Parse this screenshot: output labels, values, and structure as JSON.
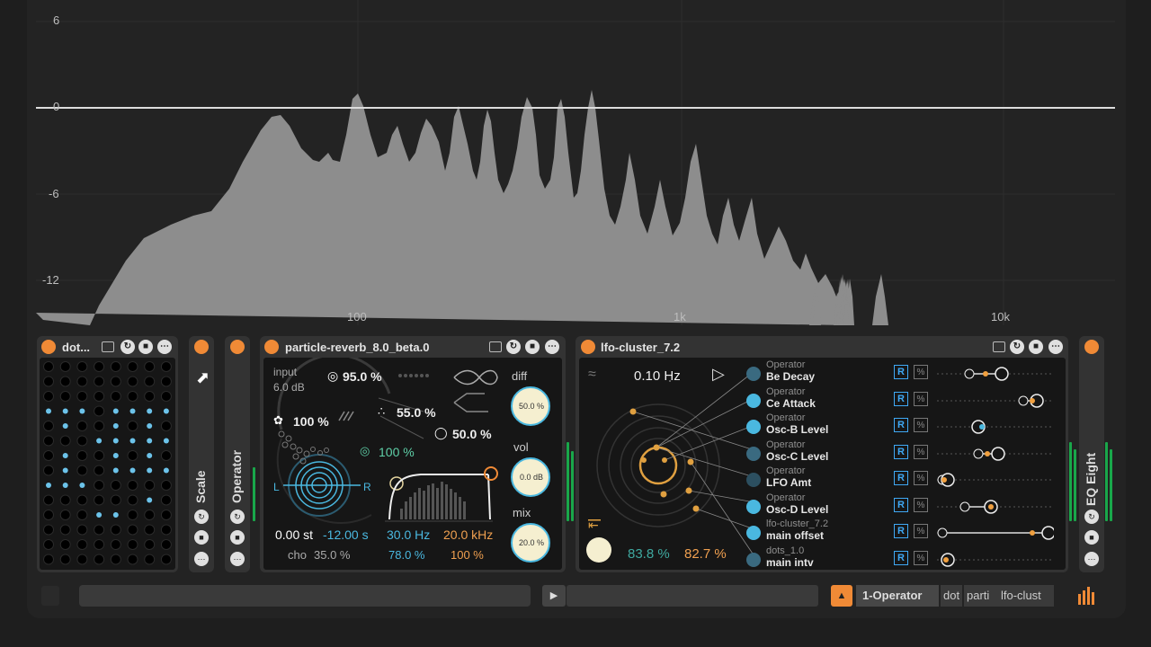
{
  "analyzer": {
    "db_labels": [
      "6",
      "0",
      "-6",
      "-12"
    ],
    "freq_labels": [
      "100",
      "1k",
      "10k"
    ]
  },
  "devices": {
    "dots": {
      "title": "dot..."
    },
    "scale": {
      "title": "Scale"
    },
    "operator": {
      "title": "Operator"
    },
    "reverb": {
      "title": "particle-reverb_8.0_beta.0",
      "input_label": "input",
      "input_value": "6.0 dB",
      "p1": "95.0 %",
      "p2": "100 %",
      "p3": "55.0 %",
      "p4": "50.0 %",
      "p5": "100 %",
      "L": "L",
      "R": "R",
      "pitch": "0.00 st",
      "time": "-12.00 s",
      "freq_low": "30.0 Hz",
      "freq_high": "20.0 kHz",
      "cho_label": "cho",
      "cho_value": "35.0 %",
      "v2": "78.0 %",
      "v3": "100 %",
      "diff_label": "diff",
      "diff_value": "50.0 %",
      "vol_label": "vol",
      "vol_value": "0.0 dB",
      "mix_label": "mix",
      "mix_value": "20.0 %"
    },
    "lfo": {
      "title": "lfo-cluster_7.2",
      "rate": "0.10 Hz",
      "pct1": "83.8 %",
      "pct2": "82.7 %",
      "targets": [
        {
          "device": "Operator",
          "param": "Be Decay",
          "color": "#3a6a80"
        },
        {
          "device": "Operator",
          "param": "Ce Attack",
          "color": "#4ab8e0"
        },
        {
          "device": "Operator",
          "param": "Osc-B Level",
          "color": "#4ab8e0"
        },
        {
          "device": "Operator",
          "param": "Osc-C Level",
          "color": "#3a6a80"
        },
        {
          "device": "Operator",
          "param": "LFO Amt",
          "color": "#2c4f60"
        },
        {
          "device": "Operator",
          "param": "Osc-D Level",
          "color": "#4ab8e0"
        },
        {
          "device": "lfo-cluster_7.2",
          "param": "main offset",
          "color": "#4ab8e0"
        },
        {
          "device": "dots_1.0",
          "param": "main intv",
          "color": "#3a6a80"
        }
      ],
      "r_label": "R",
      "p_label": "%"
    },
    "eq": {
      "title": "EQ Eight"
    }
  },
  "bottom": {
    "selected_track": "1-Operator",
    "chain": [
      "dot",
      "parti",
      "lfo-clust"
    ]
  },
  "colors": {
    "accent": "#f08a36",
    "blue": "#4ab8e0",
    "cream": "#f5efd0"
  }
}
